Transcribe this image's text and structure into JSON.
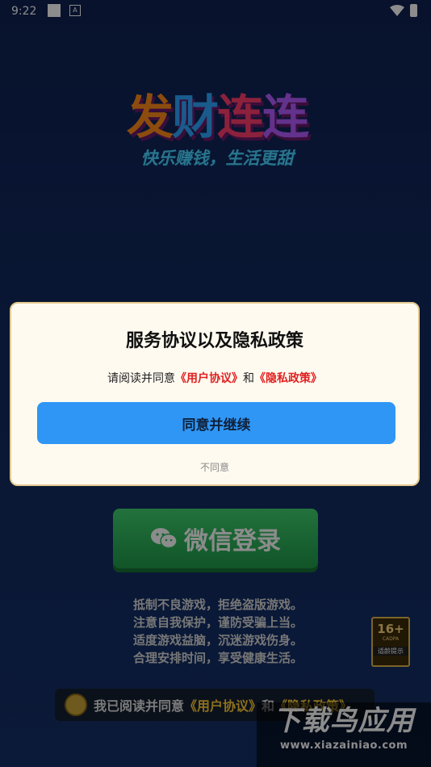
{
  "status_bar": {
    "time": "9:22",
    "notif_letter": "A"
  },
  "logo": {
    "title_chars": [
      "发",
      "财",
      "连",
      "连"
    ],
    "slogan": "快乐赚钱，生活更甜"
  },
  "wechat_login": {
    "label": "微信登录"
  },
  "tips": {
    "line1": "抵制不良游戏，拒绝盗版游戏。",
    "line2": "注意自我保护，谨防受骗上当。",
    "line3": "适度游戏益脑，沉迷游戏伤身。",
    "line4": "合理安排时间，享受健康生活。"
  },
  "age_badge": {
    "rating": "16+",
    "org": "CADPA",
    "label": "适龄提示"
  },
  "agreement_bar": {
    "prefix": "我已阅读并同意",
    "user_link": "《用户协议》",
    "and": "和",
    "privacy_link": "《隐私政策》"
  },
  "dialog": {
    "title": "服务协议以及隐私政策",
    "msg_prefix": "请阅读并同意",
    "user_link": "《用户协议》",
    "and": "和",
    "privacy_link": "《隐私政策》",
    "agree_button": "同意并继续",
    "disagree": "不同意"
  },
  "watermark": {
    "text": "下载鸟应用",
    "url": "www.xiazainiao.com"
  },
  "colors": {
    "primary_button": "#2f96f5",
    "link_red": "#e02020",
    "link_yellow": "#ffcc33",
    "wechat_green": "#1f9a4a"
  }
}
